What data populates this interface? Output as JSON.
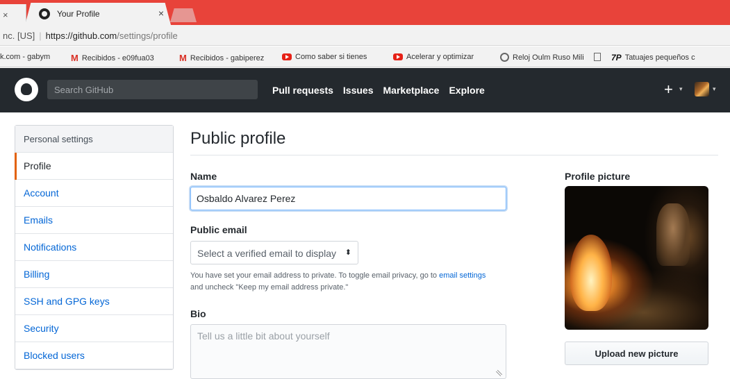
{
  "browser": {
    "prev_tab_close": "×",
    "active_tab": {
      "title": "Your Profile",
      "close": "×"
    },
    "address": {
      "host_label": "nc. [US]",
      "url_main": "https://github.com",
      "url_path": "/settings/profile"
    },
    "bookmarks": [
      {
        "label": "k.com - gabym",
        "icon": ""
      },
      {
        "label": "Recibidos - e09fua03",
        "icon": "gmail-icon"
      },
      {
        "label": "Recibidos - gabiperez",
        "icon": "gmail-icon"
      },
      {
        "label": "Como saber si tienes",
        "icon": "youtube-icon"
      },
      {
        "label": "Acelerar y optimizar",
        "icon": "youtube-icon"
      },
      {
        "label": "Reloj Oulm Ruso Mili",
        "icon": "watch-icon"
      },
      {
        "label": "",
        "icon": "page-icon"
      },
      {
        "label": "Tatuajes pequeños c",
        "icon": "tp-icon",
        "icon_text": "7P"
      }
    ]
  },
  "github_header": {
    "search_placeholder": "Search GitHub",
    "nav": [
      "Pull requests",
      "Issues",
      "Marketplace",
      "Explore"
    ],
    "plus": "+",
    "caret": "▾"
  },
  "sidebar": {
    "header": "Personal settings",
    "items": [
      {
        "label": "Profile",
        "selected": true
      },
      {
        "label": "Account",
        "selected": false
      },
      {
        "label": "Emails",
        "selected": false
      },
      {
        "label": "Notifications",
        "selected": false
      },
      {
        "label": "Billing",
        "selected": false
      },
      {
        "label": "SSH and GPG keys",
        "selected": false
      },
      {
        "label": "Security",
        "selected": false
      },
      {
        "label": "Blocked users",
        "selected": false
      }
    ]
  },
  "main": {
    "title": "Public profile",
    "name_label": "Name",
    "name_value": "Osbaldo Alvarez Perez",
    "email_label": "Public email",
    "email_select": "Select a verified email to display",
    "email_select_caret": "⬍",
    "email_note_before": "You have set your email address to private. To toggle email privacy, go to ",
    "email_note_link": "email settings",
    "email_note_after": " and uncheck \"Keep my email address private.\"",
    "bio_label": "Bio",
    "bio_placeholder": "Tell us a little bit about yourself"
  },
  "profile_picture": {
    "label": "Profile picture",
    "upload_button": "Upload new picture"
  },
  "colors": {
    "chrome_tab_bar": "#e8433a",
    "github_header": "#24292e",
    "link": "#0366d6",
    "selected_indicator": "#e36209"
  }
}
